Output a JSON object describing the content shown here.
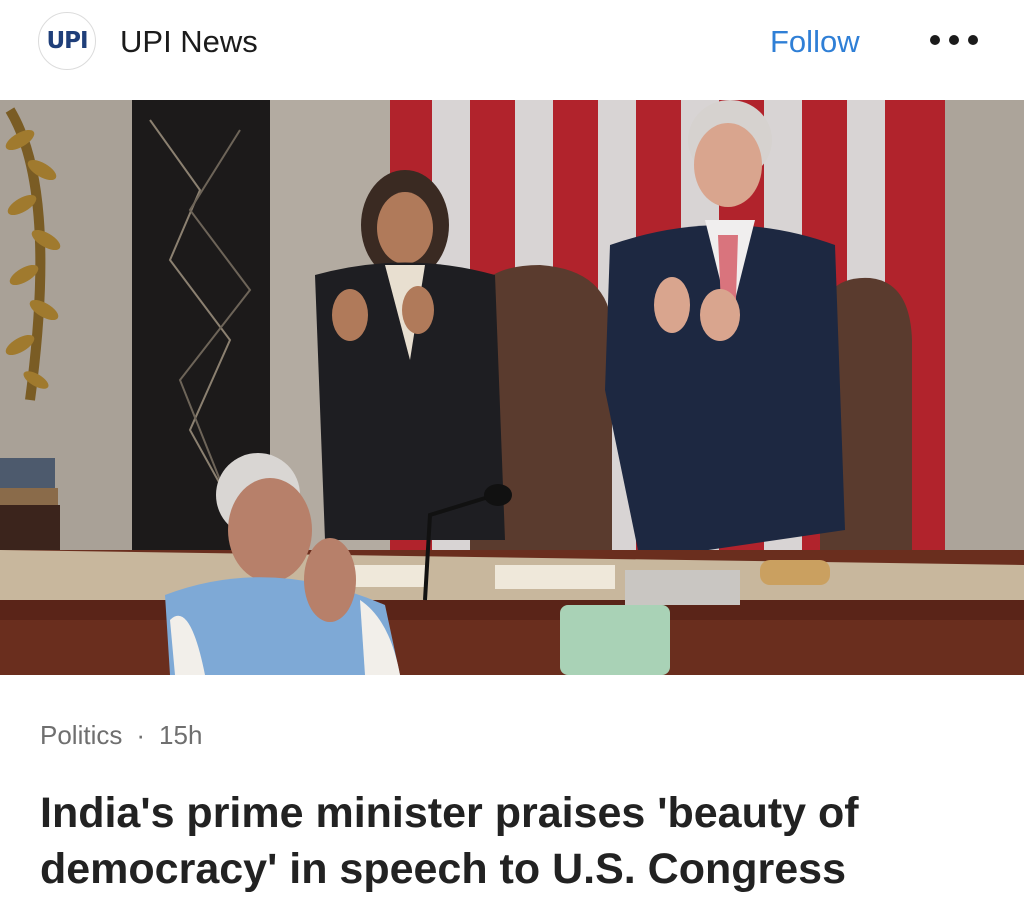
{
  "header": {
    "logo_text": "UPI",
    "publisher_name": "UPI News",
    "follow_label": "Follow",
    "more_icon": "more-horizontal-icon"
  },
  "article": {
    "category": "Politics",
    "separator": "·",
    "time_ago": "15h",
    "headline": "India's prime minister praises 'beauty of democracy' in speech to U.S. Congress"
  },
  "colors": {
    "follow_blue": "#2f7fd6",
    "logo_navy": "#1f3f7a",
    "meta_gray": "#6f6f6f"
  }
}
